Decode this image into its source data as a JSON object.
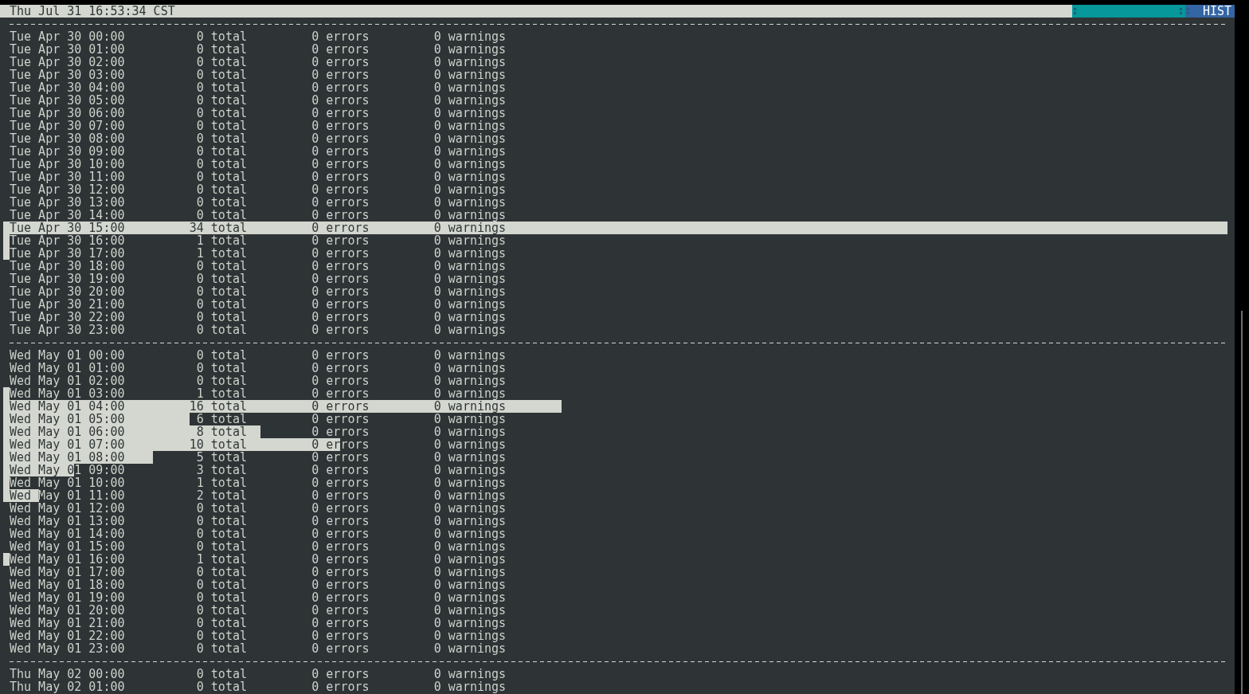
{
  "status_bar": {
    "clock": "Thu Jul 31 16:53:34 CST",
    "mode": "HIST"
  },
  "groups": [
    {
      "rows": [
        {
          "time": "Tue Apr 30 00:00",
          "total": "0 total",
          "errors": "0 errors",
          "warnings": "0 warnings"
        },
        {
          "time": "Tue Apr 30 01:00",
          "total": "0 total",
          "errors": "0 errors",
          "warnings": "0 warnings"
        },
        {
          "time": "Tue Apr 30 02:00",
          "total": "0 total",
          "errors": "0 errors",
          "warnings": "0 warnings"
        },
        {
          "time": "Tue Apr 30 03:00",
          "total": "0 total",
          "errors": "0 errors",
          "warnings": "0 warnings"
        },
        {
          "time": "Tue Apr 30 04:00",
          "total": "0 total",
          "errors": "0 errors",
          "warnings": "0 warnings"
        },
        {
          "time": "Tue Apr 30 05:00",
          "total": "0 total",
          "errors": "0 errors",
          "warnings": "0 warnings"
        },
        {
          "time": "Tue Apr 30 06:00",
          "total": "0 total",
          "errors": "0 errors",
          "warnings": "0 warnings"
        },
        {
          "time": "Tue Apr 30 07:00",
          "total": "0 total",
          "errors": "0 errors",
          "warnings": "0 warnings"
        },
        {
          "time": "Tue Apr 30 08:00",
          "total": "0 total",
          "errors": "0 errors",
          "warnings": "0 warnings"
        },
        {
          "time": "Tue Apr 30 09:00",
          "total": "0 total",
          "errors": "0 errors",
          "warnings": "0 warnings"
        },
        {
          "time": "Tue Apr 30 10:00",
          "total": "0 total",
          "errors": "0 errors",
          "warnings": "0 warnings"
        },
        {
          "time": "Tue Apr 30 11:00",
          "total": "0 total",
          "errors": "0 errors",
          "warnings": "0 warnings"
        },
        {
          "time": "Tue Apr 30 12:00",
          "total": "0 total",
          "errors": "0 errors",
          "warnings": "0 warnings"
        },
        {
          "time": "Tue Apr 30 13:00",
          "total": "0 total",
          "errors": "0 errors",
          "warnings": "0 warnings"
        },
        {
          "time": "Tue Apr 30 14:00",
          "total": "0 total",
          "errors": "0 errors",
          "warnings": "0 warnings"
        },
        {
          "time": "Tue Apr 30 15:00",
          "total": "34 total",
          "errors": "0 errors",
          "warnings": "0 warnings",
          "level": 1
        },
        {
          "time": "Tue Apr 30 16:00",
          "total": "1 total",
          "errors": "0 errors",
          "warnings": "0 warnings",
          "level": 0.005
        },
        {
          "time": "Tue Apr 30 17:00",
          "total": "1 total",
          "errors": "0 errors",
          "warnings": "0 warnings",
          "level": 0.005
        },
        {
          "time": "Tue Apr 30 18:00",
          "total": "0 total",
          "errors": "0 errors",
          "warnings": "0 warnings"
        },
        {
          "time": "Tue Apr 30 19:00",
          "total": "0 total",
          "errors": "0 errors",
          "warnings": "0 warnings"
        },
        {
          "time": "Tue Apr 30 20:00",
          "total": "0 total",
          "errors": "0 errors",
          "warnings": "0 warnings"
        },
        {
          "time": "Tue Apr 30 21:00",
          "total": "0 total",
          "errors": "0 errors",
          "warnings": "0 warnings"
        },
        {
          "time": "Tue Apr 30 22:00",
          "total": "0 total",
          "errors": "0 errors",
          "warnings": "0 warnings"
        },
        {
          "time": "Tue Apr 30 23:00",
          "total": "0 total",
          "errors": "0 errors",
          "warnings": "0 warnings"
        }
      ]
    },
    {
      "rows": [
        {
          "time": "Wed May 01 00:00",
          "total": "0 total",
          "errors": "0 errors",
          "warnings": "0 warnings"
        },
        {
          "time": "Wed May 01 01:00",
          "total": "0 total",
          "errors": "0 errors",
          "warnings": "0 warnings"
        },
        {
          "time": "Wed May 01 02:00",
          "total": "0 total",
          "errors": "0 errors",
          "warnings": "0 warnings"
        },
        {
          "time": "Wed May 01 03:00",
          "total": "1 total",
          "errors": "0 errors",
          "warnings": "0 warnings",
          "level": 0.005
        },
        {
          "time": "Wed May 01 04:00",
          "total": "16 total",
          "errors": "0 errors",
          "warnings": "0 warnings",
          "level": 0.456
        },
        {
          "time": "Wed May 01 05:00",
          "total": "6 total",
          "errors": "0 errors",
          "warnings": "0 warnings",
          "level": 0.152
        },
        {
          "time": "Wed May 01 06:00",
          "total": "8 total",
          "errors": "0 errors",
          "warnings": "0 warnings",
          "level": 0.21
        },
        {
          "time": "Wed May 01 07:00",
          "total": "10 total",
          "errors": "0 errors",
          "warnings": "0 warnings",
          "level": 0.275
        },
        {
          "time": "Wed May 01 08:00",
          "total": "5 total",
          "errors": "0 errors",
          "warnings": "0 warnings",
          "level": 0.122
        },
        {
          "time": "Wed May 01 09:00",
          "total": "3 total",
          "errors": "0 errors",
          "warnings": "0 warnings",
          "level": 0.058
        },
        {
          "time": "Wed May 01 10:00",
          "total": "1 total",
          "errors": "0 errors",
          "warnings": "0 warnings",
          "level": 0.005
        },
        {
          "time": "Wed May 01 11:00",
          "total": "2 total",
          "errors": "0 errors",
          "warnings": "0 warnings",
          "level": 0.029
        },
        {
          "time": "Wed May 01 12:00",
          "total": "0 total",
          "errors": "0 errors",
          "warnings": "0 warnings"
        },
        {
          "time": "Wed May 01 13:00",
          "total": "0 total",
          "errors": "0 errors",
          "warnings": "0 warnings"
        },
        {
          "time": "Wed May 01 14:00",
          "total": "0 total",
          "errors": "0 errors",
          "warnings": "0 warnings"
        },
        {
          "time": "Wed May 01 15:00",
          "total": "0 total",
          "errors": "0 errors",
          "warnings": "0 warnings"
        },
        {
          "time": "Wed May 01 16:00",
          "total": "1 total",
          "errors": "0 errors",
          "warnings": "0 warnings",
          "level": 0.005
        },
        {
          "time": "Wed May 01 17:00",
          "total": "0 total",
          "errors": "0 errors",
          "warnings": "0 warnings"
        },
        {
          "time": "Wed May 01 18:00",
          "total": "0 total",
          "errors": "0 errors",
          "warnings": "0 warnings"
        },
        {
          "time": "Wed May 01 19:00",
          "total": "0 total",
          "errors": "0 errors",
          "warnings": "0 warnings"
        },
        {
          "time": "Wed May 01 20:00",
          "total": "0 total",
          "errors": "0 errors",
          "warnings": "0 warnings"
        },
        {
          "time": "Wed May 01 21:00",
          "total": "0 total",
          "errors": "0 errors",
          "warnings": "0 warnings"
        },
        {
          "time": "Wed May 01 22:00",
          "total": "0 total",
          "errors": "0 errors",
          "warnings": "0 warnings"
        },
        {
          "time": "Wed May 01 23:00",
          "total": "0 total",
          "errors": "0 errors",
          "warnings": "0 warnings"
        }
      ]
    },
    {
      "rows": [
        {
          "time": "Thu May 02 00:00",
          "total": "0 total",
          "errors": "0 errors",
          "warnings": "0 warnings"
        },
        {
          "time": "Thu May 02 01:00",
          "total": "0 total",
          "errors": "0 errors",
          "warnings": "0 warnings"
        }
      ]
    }
  ]
}
